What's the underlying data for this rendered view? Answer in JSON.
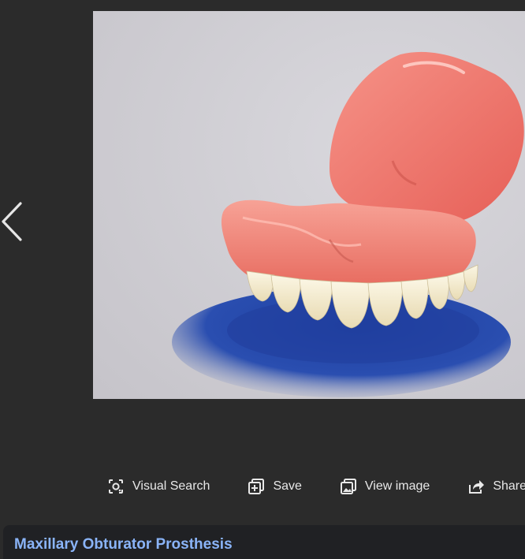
{
  "viewer": {
    "nav": {
      "previous_icon": "chevron-left-icon"
    },
    "image": {
      "subject": "upper denture obturator on blue base",
      "background_color": "#cfcdd3"
    }
  },
  "actions": [
    {
      "id": "visual-search",
      "label": "Visual Search",
      "icon": "lens-icon"
    },
    {
      "id": "save",
      "label": "Save",
      "icon": "add-to-collection-icon"
    },
    {
      "id": "view-image",
      "label": "View image",
      "icon": "open-image-icon"
    },
    {
      "id": "share",
      "label": "Share",
      "icon": "share-icon"
    }
  ],
  "result": {
    "title": "Maxillary Obturator Prosthesis"
  },
  "colors": {
    "background": "#2b2b2b",
    "card": "#202124",
    "link": "#8ab4f8",
    "text": "#e8e8e8"
  }
}
